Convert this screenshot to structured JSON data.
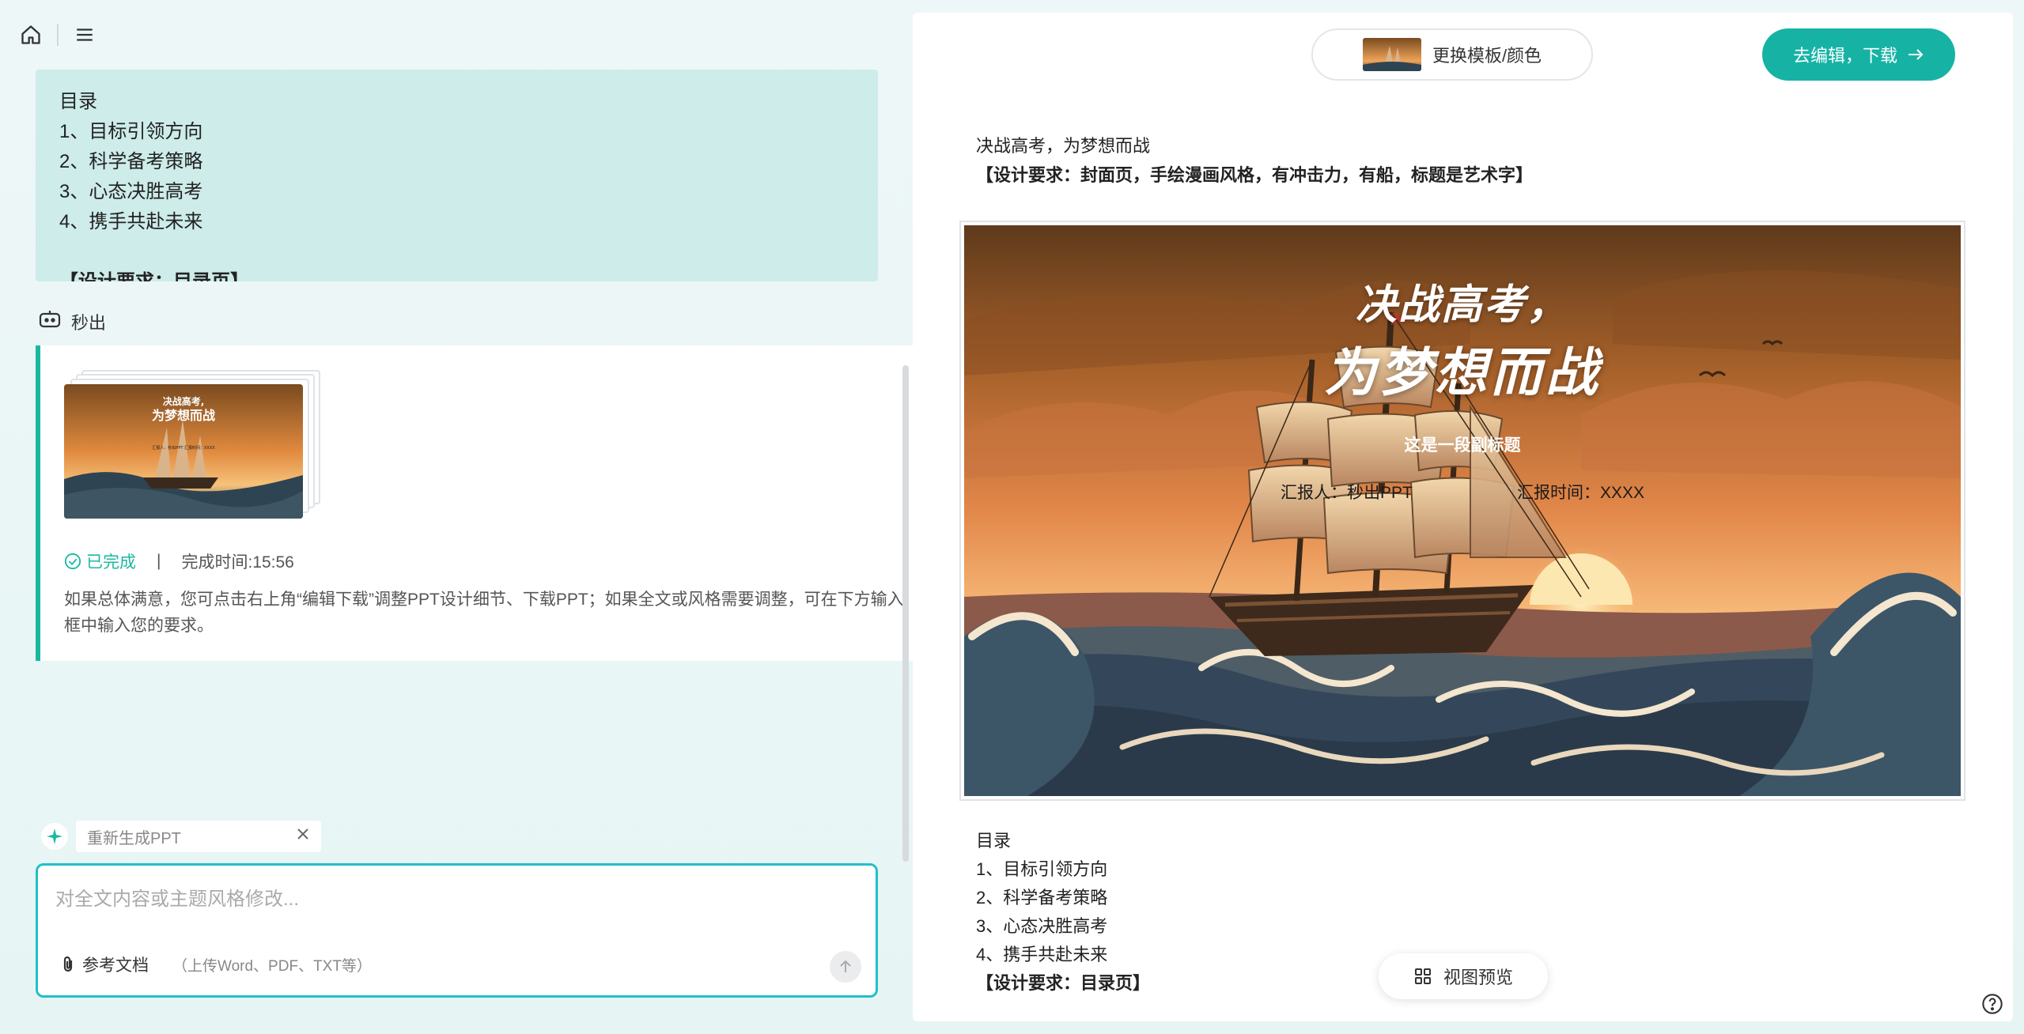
{
  "outline": {
    "heading": "目录",
    "items": [
      "1、目标引领方向",
      "2、科学备考策略",
      "3、心态决胜高考",
      "4、携手共赴未来"
    ],
    "requirement": "【设计要求：目录页】"
  },
  "source": {
    "label": "秒出"
  },
  "result": {
    "thumb": {
      "title1": "决战高考,",
      "title2": "为梦想而战",
      "meta": "汇报人：秒出PPT     汇报时间：XXXX"
    },
    "status": "已完成",
    "separator": "|",
    "time": "完成时间:15:56",
    "note": "如果总体满意，您可点击右上角“编辑下载”调整PPT设计细节、下载PPT；如果全文或风格需要调整，可在下方输入框中输入您的要求。"
  },
  "regen": {
    "label": "重新生成PPT"
  },
  "input": {
    "placeholder": "对全文内容或主题风格修改...",
    "attach_label": "参考文档",
    "attach_hint": "（上传Word、PDF、TXT等）"
  },
  "preview": {
    "template_label": "更换模板/颜色",
    "go_edit_label": "去编辑，下载",
    "slide1": {
      "caption": "决战高考，为梦想而战",
      "requirement": "【设计要求：封面页，手绘漫画风格，有冲击力，有船，标题是艺术字】",
      "title1": "决战高考，",
      "title2": "为梦想而战",
      "subtitle": "这是一段副标题",
      "reporter": "汇报人：秒出PPT",
      "report_time": "汇报时间：XXXX"
    },
    "toc": {
      "heading": "目录",
      "items": [
        "1、目标引领方向",
        "2、科学备考策略",
        "3、心态决胜高考",
        "4、携手共赴未来"
      ],
      "requirement": "【设计要求：目录页】"
    },
    "view_preview_label": "视图预览"
  },
  "colors": {
    "accent": "#16b3a5",
    "outline_bg": "#cdecea",
    "input_border": "#22c0c6"
  }
}
